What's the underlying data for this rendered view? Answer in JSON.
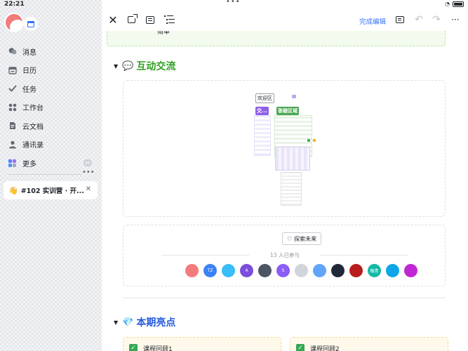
{
  "status_bar": {
    "time": "22:21",
    "dots": "•••",
    "battery_percent": 85
  },
  "sidebar": {
    "items": [
      {
        "label": "消息",
        "icon": "chat-bubble-icon"
      },
      {
        "label": "日历",
        "icon": "calendar-icon"
      },
      {
        "label": "任务",
        "icon": "checkmark-icon"
      },
      {
        "label": "工作台",
        "icon": "apps-icon"
      },
      {
        "label": "云文档",
        "icon": "cloud-doc-icon"
      },
      {
        "label": "通讯录",
        "icon": "contacts-icon"
      },
      {
        "label": "更多",
        "icon": "more-grid-icon",
        "badge": "88"
      }
    ],
    "ellipsis": "•••",
    "pinned_chat": {
      "emoji": "👋",
      "title": "#102 实训营 · 开...",
      "close": "✕"
    }
  },
  "toolbar": {
    "close": "✕",
    "finish_edit_label": "完成编辑",
    "undo": "↶",
    "redo": "↷",
    "more": "···"
  },
  "document": {
    "top_callout_text": "简单",
    "section_interaction": {
      "emoji": "💬",
      "title": "互动交流",
      "color": "#2ea121"
    },
    "whiteboard": {
      "welcome_label": "欢迎区",
      "tag1": "交...",
      "tag2": "答疑区域"
    },
    "explore": {
      "button_label": "探索未来",
      "participants_text": "13 人已参与",
      "avatars": [
        {
          "text": "",
          "color": "#f27c7c"
        },
        {
          "text": "TZ",
          "color": "#3b82f6"
        },
        {
          "text": "",
          "color": "#38bdf8"
        },
        {
          "text": "A",
          "color": "#7c4ddb"
        },
        {
          "text": "",
          "color": "#4b5563"
        },
        {
          "text": "S",
          "color": "#8b5cf6"
        },
        {
          "text": "",
          "color": "#d1d5db"
        },
        {
          "text": "",
          "color": "#60a5fa"
        },
        {
          "text": "",
          "color": "#1f2937"
        },
        {
          "text": "",
          "color": "#b91c1c"
        },
        {
          "text": "融青",
          "color": "#14b8a6"
        },
        {
          "text": "",
          "color": "#0ea5e9"
        },
        {
          "text": "",
          "color": "#c026d3"
        }
      ]
    },
    "section_highlights": {
      "emoji": "💎",
      "title": "本期亮点",
      "color": "#245bdb"
    },
    "review_cards": [
      {
        "check": "✓",
        "label": "课程回顾1"
      },
      {
        "check": "✓",
        "label": "课程回顾2"
      }
    ]
  }
}
